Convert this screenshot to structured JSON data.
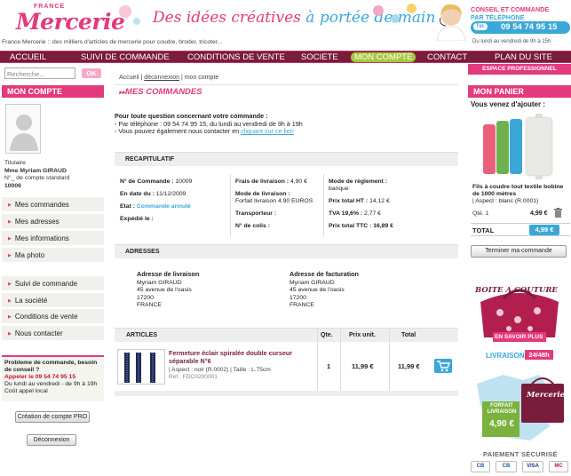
{
  "header": {
    "logo_top": "FRANCE",
    "logo_main": "Mercerie",
    "tagline_a": "Des idées créatives",
    "tagline_b": "à portée de main",
    "description": "France Mercerie :: des milliers d'articles de mercerie pour coudre, broder, tricoter...",
    "cta_line1": "CONSEIL ET COMMANDE",
    "cta_line2": "PAR TÉLÉPHONE",
    "tel_label": "Tél.",
    "phone": "09 54 74 95 15",
    "hours": "Du lundi au vendredi de 9h à 15h"
  },
  "nav": {
    "items": [
      "ACCUEIL",
      "SUIVI DE COMMANDE",
      "CONDITIONS DE VENTE",
      "SOCIETE",
      "MON COMPTE",
      "CONTACT",
      "PLAN DU SITE"
    ],
    "pro": "ESPACE PROFESSIONNEL"
  },
  "search": {
    "placeholder": "Recherche...",
    "button": "OK"
  },
  "left": {
    "title": "MON COMPTE",
    "titulaire": "Titulaire",
    "name": "Mme Myriam GIRAUD",
    "compte_label": "N°_ de compte standard",
    "compte": "10006",
    "menu1": [
      "Mes commandes",
      "Mes adresses",
      "Mes informations",
      "Ma photo"
    ],
    "menu2": [
      "Suivi de commande",
      "La société",
      "Conditions de vente",
      "Nous contacter"
    ],
    "problem_title": "Probleme de commande, besoin de conseil ?",
    "problem_call": "Appeler le 09 54 74 95 15",
    "problem_hours": "Du lundi au vendredi - de 9h à 19h",
    "problem_cost": "Coût appel local",
    "btn_pro": "Création de compte PRO",
    "btn_logout": "Déconnexion"
  },
  "main": {
    "breadcrumb": [
      "Accueil",
      "déconnexion",
      "mon compte"
    ],
    "title": "MES COMMANDES",
    "contact_head": "Pour toute question concernant votre commande :",
    "contact_tel": "- Par téléphone : 09 54 74 95 15, du lundi au vendredi de 9h à 19h",
    "contact_mail": "- Vous pouvez également nous contacter en",
    "contact_link": "cliquant sur ce lien",
    "recap_title": "RECAPITULATIF",
    "recap": {
      "num_label": "N° de Commande :",
      "num": "10009",
      "date_label": "En date du :",
      "date": "11/12/2009",
      "etat_label": "Etat :",
      "etat": "Commande annulé",
      "exp_label": "Expédié le :",
      "frais_label": "Frais de livraison :",
      "frais": "4,90 €",
      "mode_liv_label": "Mode de livraison :",
      "mode_liv": "Forfait livraison 4.90 EUROS",
      "transp_label": "Transporteur :",
      "colis_label": "N° de colis :",
      "mode_reg_label": "Mode de règlement :",
      "mode_reg": "banque",
      "ht_label": "Prix total HT :",
      "ht": "14,12 €",
      "tva_label": "TVA 19,6% :",
      "tva": "2,77 €",
      "ttc_label": "Prix total TTC :",
      "ttc": "16,89 €"
    },
    "addr_title": "ADRESSES",
    "livraison": {
      "head": "Adresse de livraison",
      "lines": [
        "Myriam GIRAUD",
        "45 avenue de l'oasis",
        "17200",
        "FRANCE"
      ]
    },
    "facturation": {
      "head": "Adresse de facturation",
      "lines": [
        "Myriam GIRAUD",
        "45 avenue de l'oasis",
        "17200",
        "FRANCE"
      ]
    },
    "articles": {
      "cols": [
        "ARTICLES",
        "Qte.",
        "Prix unit.",
        "Total"
      ],
      "item": {
        "name": "Fermeture éclair spiralée double curseur séparable N°6",
        "desc": "| Aspect : noir (R.0002) | Taille : L.75cm",
        "ref": "Ref : FDC0200001",
        "qty": "1",
        "unit": "11,99 €",
        "total": "11,99 €"
      }
    }
  },
  "right": {
    "title": "MON PANIER",
    "added": "Vous venez d'ajouter :",
    "prod_name": "Fils à coudre tout textile bobine de 1000 mètres",
    "prod_aspect": "| Aspect : blanc (R.0001)",
    "qty": "Qté. 1",
    "price": "4,99 €",
    "total_label": "TOTAL",
    "total": "4,99 €",
    "btn_finish": "Terminer ma commande",
    "promo1_title": "BOITE A COUTURE",
    "promo1_more": "EN SAVOIR PLUS",
    "promo2_label": "LIVRAISON",
    "promo2_time": "24/48h",
    "promo2_logo": "Mercerie",
    "promo2_forfait": "FORFAIT LIVRAISON",
    "promo2_price": "4,90 €",
    "secure": "PAIEMENT SÉCURISÉ",
    "cards": [
      "CB",
      "CB",
      "VISA",
      "MC"
    ]
  }
}
